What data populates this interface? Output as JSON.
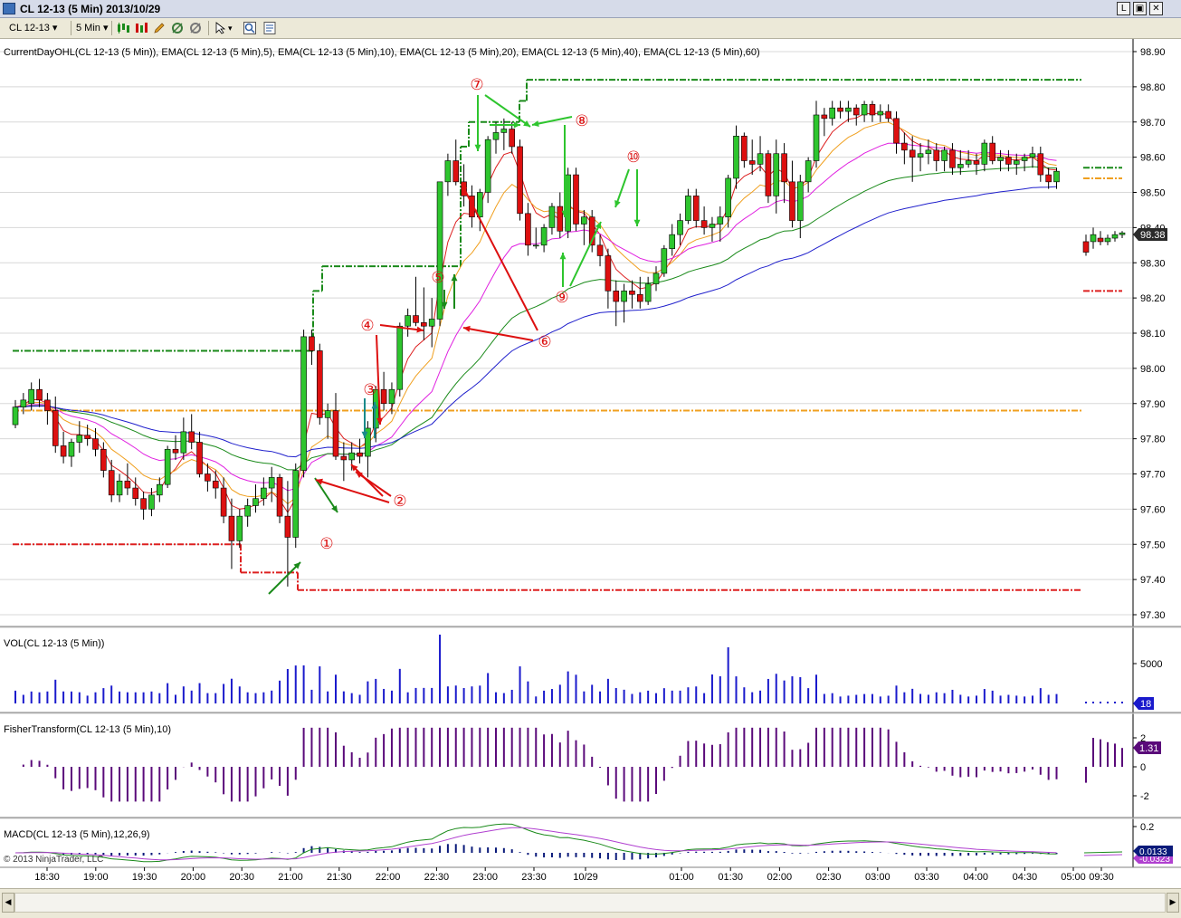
{
  "window": {
    "title": "CL 12-13 (5 Min)  2013/10/29",
    "btn_min": "L",
    "btn_max": "▣",
    "btn_close": "✕"
  },
  "toolbar": {
    "instrument": "CL 12-13",
    "interval": "5 Min"
  },
  "indicators": {
    "price_label": "CurrentDayOHL(CL 12-13 (5 Min)), EMA(CL 12-13 (5 Min),5), EMA(CL 12-13 (5 Min),10), EMA(CL 12-13 (5 Min),20), EMA(CL 12-13 (5 Min),40), EMA(CL 12-13 (5 Min),60)",
    "vol_label": "VOL(CL 12-13 (5 Min))",
    "fisher_label": "FisherTransform(CL 12-13 (5 Min),10)",
    "macd_label": "MACD(CL 12-13 (5 Min),12,26,9)",
    "copyright": "© 2013 NinjaTrader, LLC"
  },
  "chart_data": {
    "type": "candlestick",
    "instrument": "CL 12-13 (5 Min)",
    "date": "2013/10/29",
    "price_axis": {
      "ticks": [
        "98.90",
        "98.80",
        "98.70",
        "98.60",
        "98.50",
        "98.40",
        "98.30",
        "98.20",
        "98.10",
        "98.00",
        "97.90",
        "97.80",
        "97.70",
        "97.60",
        "97.50",
        "97.40",
        "97.30"
      ],
      "range": [
        97.27,
        98.93
      ]
    },
    "last_price": "98.38",
    "volume_axis": {
      "ticks": [
        "5000"
      ],
      "last": "18"
    },
    "fisher_axis": {
      "ticks": [
        "2",
        "0",
        "-2"
      ],
      "last": "1.31"
    },
    "macd_axis": {
      "ticks": [
        "0.2"
      ],
      "last": "0.0133",
      "last2": "-0.0323"
    },
    "time_labels": [
      "18:30",
      "19:00",
      "19:30",
      "20:00",
      "20:30",
      "21:00",
      "21:30",
      "22:00",
      "22:30",
      "23:00",
      "23:30",
      "10/29",
      "01:00",
      "01:30",
      "02:00",
      "02:30",
      "03:00",
      "03:30",
      "04:00",
      "04:30",
      "05:00",
      "09:30"
    ],
    "annotations": [
      "①",
      "②",
      "③",
      "④",
      "⑤",
      "⑥",
      "⑦",
      "⑧",
      "⑨",
      "⑩"
    ],
    "levels": {
      "day_high_prev": 98.05,
      "day_high_current": 98.82,
      "day_open": 97.88,
      "day_low_prev": 97.5,
      "day_low_current": 97.37,
      "right_high": 98.57,
      "right_open": 98.54,
      "right_low": 98.22
    },
    "candles": [
      {
        "o": 97.84,
        "h": 97.91,
        "l": 97.83,
        "c": 97.89
      },
      {
        "o": 97.89,
        "h": 97.93,
        "l": 97.87,
        "c": 97.91
      },
      {
        "o": 97.9,
        "h": 97.96,
        "l": 97.88,
        "c": 97.94
      },
      {
        "o": 97.94,
        "h": 97.97,
        "l": 97.89,
        "c": 97.91
      },
      {
        "o": 97.91,
        "h": 97.93,
        "l": 97.84,
        "c": 97.88
      },
      {
        "o": 97.88,
        "h": 97.92,
        "l": 97.76,
        "c": 97.78
      },
      {
        "o": 97.78,
        "h": 97.82,
        "l": 97.73,
        "c": 97.75
      },
      {
        "o": 97.75,
        "h": 97.8,
        "l": 97.72,
        "c": 97.79
      },
      {
        "o": 97.79,
        "h": 97.85,
        "l": 97.76,
        "c": 97.81
      },
      {
        "o": 97.81,
        "h": 97.84,
        "l": 97.78,
        "c": 97.8
      },
      {
        "o": 97.8,
        "h": 97.83,
        "l": 97.75,
        "c": 97.77
      },
      {
        "o": 97.77,
        "h": 97.79,
        "l": 97.69,
        "c": 97.71
      },
      {
        "o": 97.71,
        "h": 97.74,
        "l": 97.62,
        "c": 97.64
      },
      {
        "o": 97.64,
        "h": 97.7,
        "l": 97.62,
        "c": 97.68
      },
      {
        "o": 97.68,
        "h": 97.73,
        "l": 97.64,
        "c": 97.66
      },
      {
        "o": 97.66,
        "h": 97.69,
        "l": 97.61,
        "c": 97.63
      },
      {
        "o": 97.63,
        "h": 97.65,
        "l": 97.57,
        "c": 97.6
      },
      {
        "o": 97.6,
        "h": 97.66,
        "l": 97.58,
        "c": 97.64
      },
      {
        "o": 97.64,
        "h": 97.69,
        "l": 97.62,
        "c": 97.67
      },
      {
        "o": 97.67,
        "h": 97.78,
        "l": 97.66,
        "c": 97.77
      },
      {
        "o": 97.77,
        "h": 97.81,
        "l": 97.74,
        "c": 97.76
      },
      {
        "o": 97.76,
        "h": 97.86,
        "l": 97.74,
        "c": 97.82
      },
      {
        "o": 97.82,
        "h": 97.87,
        "l": 97.77,
        "c": 97.79
      },
      {
        "o": 97.79,
        "h": 97.82,
        "l": 97.69,
        "c": 97.7
      },
      {
        "o": 97.7,
        "h": 97.73,
        "l": 97.65,
        "c": 97.68
      },
      {
        "o": 97.68,
        "h": 97.71,
        "l": 97.63,
        "c": 97.66
      },
      {
        "o": 97.66,
        "h": 97.69,
        "l": 97.56,
        "c": 97.58
      },
      {
        "o": 97.58,
        "h": 97.63,
        "l": 97.43,
        "c": 97.51
      },
      {
        "o": 97.51,
        "h": 97.6,
        "l": 97.49,
        "c": 97.58
      },
      {
        "o": 97.58,
        "h": 97.63,
        "l": 97.55,
        "c": 97.61
      },
      {
        "o": 97.61,
        "h": 97.67,
        "l": 97.59,
        "c": 97.63
      },
      {
        "o": 97.63,
        "h": 97.69,
        "l": 97.61,
        "c": 97.66
      },
      {
        "o": 97.66,
        "h": 97.72,
        "l": 97.62,
        "c": 97.69
      },
      {
        "o": 97.69,
        "h": 97.7,
        "l": 97.56,
        "c": 97.58
      },
      {
        "o": 97.58,
        "h": 97.68,
        "l": 97.38,
        "c": 97.52
      },
      {
        "o": 97.52,
        "h": 97.73,
        "l": 97.49,
        "c": 97.71
      },
      {
        "o": 97.71,
        "h": 98.11,
        "l": 97.69,
        "c": 98.09
      },
      {
        "o": 98.09,
        "h": 98.11,
        "l": 98.01,
        "c": 98.05
      },
      {
        "o": 98.05,
        "h": 98.07,
        "l": 97.84,
        "c": 97.86
      },
      {
        "o": 97.86,
        "h": 97.9,
        "l": 97.8,
        "c": 97.88
      },
      {
        "o": 97.88,
        "h": 97.93,
        "l": 97.74,
        "c": 97.75
      },
      {
        "o": 97.75,
        "h": 97.79,
        "l": 97.68,
        "c": 97.74
      },
      {
        "o": 97.74,
        "h": 97.79,
        "l": 97.71,
        "c": 97.76
      },
      {
        "o": 97.76,
        "h": 97.8,
        "l": 97.73,
        "c": 97.75
      },
      {
        "o": 97.75,
        "h": 97.85,
        "l": 97.69,
        "c": 97.83
      },
      {
        "o": 97.83,
        "h": 97.95,
        "l": 97.79,
        "c": 97.94
      },
      {
        "o": 97.94,
        "h": 97.99,
        "l": 97.88,
        "c": 97.9
      },
      {
        "o": 97.9,
        "h": 97.96,
        "l": 97.87,
        "c": 97.94
      },
      {
        "o": 97.94,
        "h": 98.13,
        "l": 97.92,
        "c": 98.12
      },
      {
        "o": 98.12,
        "h": 98.17,
        "l": 98.09,
        "c": 98.15
      },
      {
        "o": 98.15,
        "h": 98.26,
        "l": 98.12,
        "c": 98.13
      },
      {
        "o": 98.13,
        "h": 98.23,
        "l": 98.08,
        "c": 98.12
      },
      {
        "o": 98.12,
        "h": 98.2,
        "l": 98.06,
        "c": 98.14
      },
      {
        "o": 98.14,
        "h": 98.52,
        "l": 98.12,
        "c": 98.53
      },
      {
        "o": 98.53,
        "h": 98.61,
        "l": 98.49,
        "c": 98.59
      },
      {
        "o": 98.59,
        "h": 98.65,
        "l": 98.52,
        "c": 98.53
      },
      {
        "o": 98.53,
        "h": 98.58,
        "l": 98.46,
        "c": 98.49
      },
      {
        "o": 98.49,
        "h": 98.52,
        "l": 98.4,
        "c": 98.43
      },
      {
        "o": 98.43,
        "h": 98.51,
        "l": 98.39,
        "c": 98.5
      },
      {
        "o": 98.5,
        "h": 98.66,
        "l": 98.47,
        "c": 98.65
      },
      {
        "o": 98.65,
        "h": 98.7,
        "l": 98.61,
        "c": 98.67
      },
      {
        "o": 98.67,
        "h": 98.71,
        "l": 98.62,
        "c": 98.68
      },
      {
        "o": 98.68,
        "h": 98.7,
        "l": 98.61,
        "c": 98.63
      },
      {
        "o": 98.63,
        "h": 98.65,
        "l": 98.42,
        "c": 98.44
      },
      {
        "o": 98.44,
        "h": 98.47,
        "l": 98.32,
        "c": 98.35
      },
      {
        "o": 98.35,
        "h": 98.4,
        "l": 98.34,
        "c": 98.35
      },
      {
        "o": 98.35,
        "h": 98.41,
        "l": 98.33,
        "c": 98.4
      },
      {
        "o": 98.4,
        "h": 98.47,
        "l": 98.38,
        "c": 98.46
      },
      {
        "o": 98.46,
        "h": 98.5,
        "l": 98.37,
        "c": 98.39
      },
      {
        "o": 98.39,
        "h": 98.57,
        "l": 98.37,
        "c": 98.55
      },
      {
        "o": 98.55,
        "h": 98.57,
        "l": 98.39,
        "c": 98.41
      },
      {
        "o": 98.41,
        "h": 98.45,
        "l": 98.35,
        "c": 98.43
      },
      {
        "o": 98.43,
        "h": 98.45,
        "l": 98.33,
        "c": 98.35
      },
      {
        "o": 98.35,
        "h": 98.38,
        "l": 98.29,
        "c": 98.32
      },
      {
        "o": 98.32,
        "h": 98.34,
        "l": 98.17,
        "c": 98.22
      },
      {
        "o": 98.22,
        "h": 98.25,
        "l": 98.12,
        "c": 98.19
      },
      {
        "o": 98.19,
        "h": 98.24,
        "l": 98.13,
        "c": 98.22
      },
      {
        "o": 98.22,
        "h": 98.25,
        "l": 98.17,
        "c": 98.21
      },
      {
        "o": 98.21,
        "h": 98.26,
        "l": 98.17,
        "c": 98.19
      },
      {
        "o": 98.19,
        "h": 98.26,
        "l": 98.18,
        "c": 98.24
      },
      {
        "o": 98.24,
        "h": 98.29,
        "l": 98.22,
        "c": 98.27
      },
      {
        "o": 98.27,
        "h": 98.35,
        "l": 98.26,
        "c": 98.34
      },
      {
        "o": 98.34,
        "h": 98.41,
        "l": 98.32,
        "c": 98.38
      },
      {
        "o": 98.38,
        "h": 98.44,
        "l": 98.35,
        "c": 98.42
      },
      {
        "o": 98.42,
        "h": 98.51,
        "l": 98.41,
        "c": 98.49
      },
      {
        "o": 98.49,
        "h": 98.51,
        "l": 98.4,
        "c": 98.42
      },
      {
        "o": 98.42,
        "h": 98.46,
        "l": 98.38,
        "c": 98.4
      },
      {
        "o": 98.4,
        "h": 98.43,
        "l": 98.36,
        "c": 98.41
      },
      {
        "o": 98.41,
        "h": 98.46,
        "l": 98.36,
        "c": 98.43
      },
      {
        "o": 98.43,
        "h": 98.55,
        "l": 98.4,
        "c": 98.54
      },
      {
        "o": 98.54,
        "h": 98.69,
        "l": 98.51,
        "c": 98.66
      },
      {
        "o": 98.66,
        "h": 98.67,
        "l": 98.57,
        "c": 98.59
      },
      {
        "o": 98.59,
        "h": 98.65,
        "l": 98.55,
        "c": 98.58
      },
      {
        "o": 98.58,
        "h": 98.66,
        "l": 98.56,
        "c": 98.61
      },
      {
        "o": 98.61,
        "h": 98.62,
        "l": 98.47,
        "c": 98.49
      },
      {
        "o": 98.49,
        "h": 98.65,
        "l": 98.44,
        "c": 98.61
      },
      {
        "o": 98.61,
        "h": 98.64,
        "l": 98.47,
        "c": 98.53
      },
      {
        "o": 98.53,
        "h": 98.59,
        "l": 98.4,
        "c": 98.42
      },
      {
        "o": 98.42,
        "h": 98.55,
        "l": 98.37,
        "c": 98.53
      },
      {
        "o": 98.53,
        "h": 98.6,
        "l": 98.5,
        "c": 98.59
      },
      {
        "o": 98.59,
        "h": 98.76,
        "l": 98.57,
        "c": 98.72
      },
      {
        "o": 98.72,
        "h": 98.74,
        "l": 98.66,
        "c": 98.71
      },
      {
        "o": 98.71,
        "h": 98.76,
        "l": 98.69,
        "c": 98.74
      },
      {
        "o": 98.74,
        "h": 98.76,
        "l": 98.71,
        "c": 98.73
      },
      {
        "o": 98.73,
        "h": 98.76,
        "l": 98.7,
        "c": 98.74
      },
      {
        "o": 98.74,
        "h": 98.75,
        "l": 98.69,
        "c": 98.72
      },
      {
        "o": 98.72,
        "h": 98.76,
        "l": 98.7,
        "c": 98.75
      },
      {
        "o": 98.75,
        "h": 98.76,
        "l": 98.7,
        "c": 98.72
      },
      {
        "o": 98.72,
        "h": 98.75,
        "l": 98.7,
        "c": 98.73
      },
      {
        "o": 98.73,
        "h": 98.75,
        "l": 98.7,
        "c": 98.71
      },
      {
        "o": 98.71,
        "h": 98.73,
        "l": 98.61,
        "c": 98.64
      },
      {
        "o": 98.64,
        "h": 98.67,
        "l": 98.58,
        "c": 98.62
      },
      {
        "o": 98.62,
        "h": 98.66,
        "l": 98.53,
        "c": 98.6
      },
      {
        "o": 98.6,
        "h": 98.64,
        "l": 98.56,
        "c": 98.61
      },
      {
        "o": 98.61,
        "h": 98.65,
        "l": 98.58,
        "c": 98.62
      },
      {
        "o": 98.62,
        "h": 98.64,
        "l": 98.56,
        "c": 98.59
      },
      {
        "o": 98.59,
        "h": 98.63,
        "l": 98.56,
        "c": 98.62
      },
      {
        "o": 98.62,
        "h": 98.64,
        "l": 98.55,
        "c": 98.57
      },
      {
        "o": 98.57,
        "h": 98.62,
        "l": 98.55,
        "c": 98.58
      },
      {
        "o": 98.58,
        "h": 98.62,
        "l": 98.57,
        "c": 98.59
      },
      {
        "o": 98.59,
        "h": 98.61,
        "l": 98.55,
        "c": 98.58
      },
      {
        "o": 98.58,
        "h": 98.65,
        "l": 98.56,
        "c": 98.64
      },
      {
        "o": 98.64,
        "h": 98.66,
        "l": 98.58,
        "c": 98.59
      },
      {
        "o": 98.59,
        "h": 98.62,
        "l": 98.56,
        "c": 98.6
      },
      {
        "o": 98.6,
        "h": 98.62,
        "l": 98.56,
        "c": 98.58
      },
      {
        "o": 98.58,
        "h": 98.61,
        "l": 98.55,
        "c": 98.59
      },
      {
        "o": 98.59,
        "h": 98.61,
        "l": 98.56,
        "c": 98.6
      },
      {
        "o": 98.6,
        "h": 98.63,
        "l": 98.57,
        "c": 98.61
      },
      {
        "o": 98.61,
        "h": 98.63,
        "l": 98.53,
        "c": 98.55
      },
      {
        "o": 98.55,
        "h": 98.57,
        "l": 98.51,
        "c": 98.53
      },
      {
        "o": 98.53,
        "h": 98.57,
        "l": 98.51,
        "c": 98.56
      }
    ],
    "right_candles": [
      {
        "o": 98.36,
        "h": 98.38,
        "l": 98.32,
        "c": 98.33
      },
      {
        "o": 98.36,
        "h": 98.4,
        "l": 98.34,
        "c": 98.38
      },
      {
        "o": 98.37,
        "h": 98.39,
        "l": 98.35,
        "c": 98.36
      },
      {
        "o": 98.36,
        "h": 98.38,
        "l": 98.35,
        "c": 98.37
      },
      {
        "o": 98.37,
        "h": 98.39,
        "l": 98.36,
        "c": 98.38
      },
      {
        "o": 98.38,
        "h": 98.39,
        "l": 98.37,
        "c": 98.385
      }
    ]
  }
}
